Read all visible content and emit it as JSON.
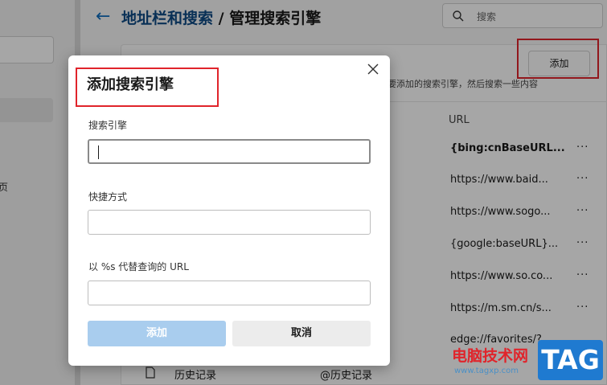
{
  "breadcrumb": {
    "parent": "地址栏和搜索",
    "separator": " / ",
    "current": "管理搜索引擎"
  },
  "search": {
    "placeholder": "搜索"
  },
  "add_button_label": "添加",
  "description_fragment": "要添加的搜索引擎，然后搜索一些内容",
  "left_nav_fragment": "页",
  "table": {
    "url_header": "URL",
    "url_rows": [
      "{bing:cnBaseURL...",
      "https://www.baid...",
      "https://www.sogo...",
      "{google:baseURL}...",
      "https://www.so.co...",
      "https://m.sm.cn/s...",
      "edge://favorites/?..."
    ],
    "more_label": "···",
    "history_row": {
      "name": "历史记录",
      "keyword": "@历史记录"
    }
  },
  "dialog": {
    "title": "添加搜索引擎",
    "fields": [
      {
        "label": "搜索引擎",
        "value": ""
      },
      {
        "label": "快捷方式",
        "value": ""
      },
      {
        "label": "以 %s 代替查询的 URL",
        "value": ""
      }
    ],
    "add_label": "添加",
    "cancel_label": "取消"
  },
  "watermark": {
    "text": "电脑技术网",
    "url": "www.tagxp.com",
    "tag": "TAG"
  },
  "colors": {
    "accent": "#0f6cbd",
    "highlight_red": "#e0242b",
    "disabled_button": "#a9cdee"
  }
}
